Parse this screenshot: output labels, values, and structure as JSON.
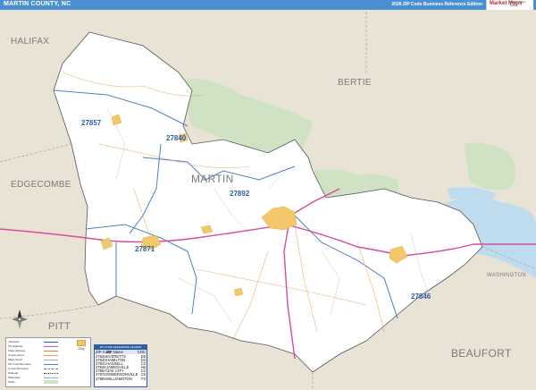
{
  "header": {
    "title": "MARTIN COUNTY, NC",
    "edition": "2026 ZIP Code Business Reference Edition",
    "logo_main": "Market Maps",
    "logo_sub": "Market Maps Online"
  },
  "counties": {
    "halifax": "HALIFAX",
    "bertie": "BERTIE",
    "edgecombe": "EDGECOMBE",
    "martin": "MARTIN",
    "pitt": "PITT",
    "washington": "WASHINGTON",
    "beaufort": "BEAUFORT"
  },
  "zip_labels": {
    "z27857": "27857",
    "z27840": "27840",
    "z27892": "27892",
    "z27871": "27871",
    "z27846": "27846"
  },
  "colors": {
    "title_bar": "#4a8fd0",
    "outside_land": "#e9e3d6",
    "county_fill": "#ffffff",
    "water": "#bfdcef",
    "wildlife_refuge": "#cfe3c4",
    "zip_boundary": "#4f7fc4",
    "highway": "#d94b9c",
    "urban": "#f2c86a"
  },
  "legend": {
    "rows": [
      "Interstate",
      "US Highway",
      "State Highway",
      "County Road",
      "Major Road",
      "ZIP Code Boundary",
      "County Boundary",
      "Railroad",
      "Waterway",
      "Parks",
      "Water"
    ],
    "icon_label": "City"
  },
  "zip_table": {
    "title": "ZIP CODE REFERENCE LEGEND",
    "columns": [
      "ZIP Code",
      "ZIP Name",
      "COC"
    ],
    "rows": [
      {
        "zip": "27825",
        "name": "EVERETTS",
        "coc": "D5"
      },
      {
        "zip": "27840",
        "name": "HAMILTON",
        "coc": "D3"
      },
      {
        "zip": "27841",
        "name": "HASSELL",
        "coc": "C3"
      },
      {
        "zip": "27846",
        "name": "JAMESVILLE",
        "coc": "H6"
      },
      {
        "zip": "27857",
        "name": "OAK CITY",
        "coc": "C2"
      },
      {
        "zip": "27871",
        "name": "ROBERSONVILLE",
        "coc": "C5"
      },
      {
        "zip": "27892",
        "name": "WILLIAMSTON",
        "coc": "F4"
      }
    ]
  },
  "compass": {
    "north_label": "N"
  }
}
